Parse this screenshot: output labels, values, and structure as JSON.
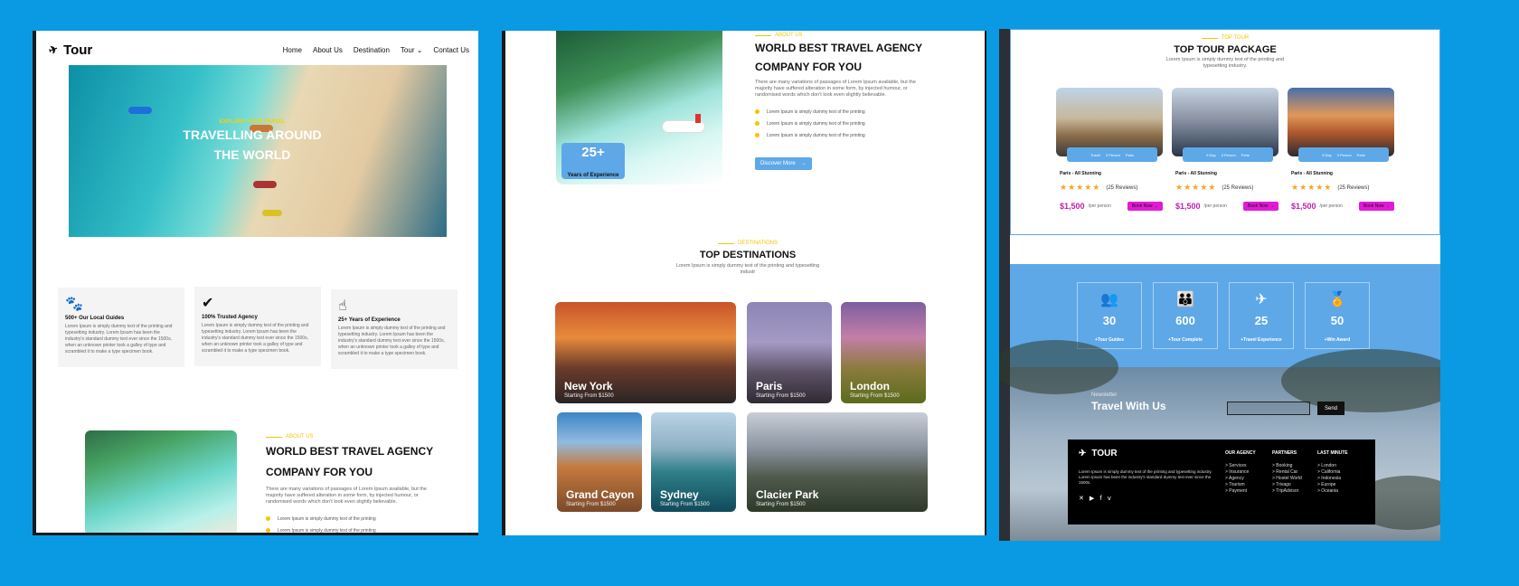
{
  "panel1": {
    "brand": "Tour",
    "nav": [
      "Home",
      "About Us",
      "Destination",
      "Tour",
      "Contact Us"
    ],
    "hero": {
      "eyebrow": "EXPLORE YOUR TRAVEL",
      "title_line1": "TRAVELLING AROUND",
      "title_line2": "THE WORLD"
    },
    "features": [
      {
        "icon": "paw-icon",
        "title": "500+ Our Local Guides",
        "text": "Lorem Ipsum is simply dummy text of the printing and typesetting industry. Lorem Ipsum has been the industry's standard dummy text ever since the 1500s, when an unknown printer took a galley of type and scrambled it to make a type specimen book."
      },
      {
        "icon": "check-circle-icon",
        "title": "100% Trusted Agency",
        "text": "Lorem Ipsum is simply dummy text of the printing and typesetting industry. Lorem Ipsum has been the industry's standard dummy text ever since the 1500s, when an unknown printer took a galley of type and scrambled it to make a type specimen book."
      },
      {
        "icon": "hand-heart-icon",
        "title": "25+ Years of Experience",
        "text": "Lorem Ipsum is simply dummy text of the printing and typesetting industry. Lorem Ipsum has been the industry's standard dummy text ever since the 1500s, when an unknown printer took a galley of type and scrambled it to make a type specimen book."
      }
    ],
    "about": {
      "eyebrow": "ABOUT US",
      "title_line1": "WORLD BEST TRAVEL AGENCY",
      "title_line2": "COMPANY FOR YOU",
      "text": "There are many variations of passages of Lorem Ipsum available, but the majority have suffered alteration in some form, by injected humour, or randomised words which don't look even slightly believable.",
      "bullets": [
        "Lorem Ipsum is simply dummy text of the printing",
        "Lorem Ipsum is simply dummy text of the printing"
      ]
    }
  },
  "panel2": {
    "experience": {
      "value": "25+",
      "label": "Years of Experience"
    },
    "about": {
      "eyebrow": "ABOUT US",
      "title_line1": "WORLD BEST TRAVEL AGENCY",
      "title_line2": "COMPANY FOR YOU",
      "text": "There are many variations of passages of Lorem Ipsum available, but the majority have suffered alteration in some form, by injected humour, or randomised words which don't look even slightly believable.",
      "bullets": [
        "Lorem Ipsum is simply dummy text of the printing",
        "Lorem Ipsum is simply dummy text of the printing",
        "Lorem Ipsum is simply dummy text of the printing"
      ],
      "button": "Discover More"
    },
    "destinations": {
      "eyebrow": "DESTINATIONS",
      "title": "TOP DESTINATIONS",
      "subtitle": "Lorem Ipsum is simply dummy text of the printing and typesetting industr",
      "items": [
        {
          "name": "New York",
          "price": "Starting From $1500"
        },
        {
          "name": "Paris",
          "price": "Starting From $1500"
        },
        {
          "name": "London",
          "price": "Starting From $1500"
        },
        {
          "name": "Grand Cayon",
          "price": "Starting From $1500"
        },
        {
          "name": "Sydney",
          "price": "Starting From $1500"
        },
        {
          "name": "Clacier Park",
          "price": "Starting From $1500"
        }
      ]
    }
  },
  "panel3": {
    "packages": {
      "eyebrow": "TOP TOUR",
      "title": "TOP TOUR PACKAGE",
      "subtitle": "Lorem Ipsum is simply dummy text of the printing and typesetting industry.",
      "cards": [
        {
          "meta": [
            "Travel",
            "3 Person",
            "Paris"
          ],
          "title": "Paris - All Stunning",
          "reviews": "(25 Reviews)",
          "price": "$1,500",
          "per": "/per person",
          "button": "Book Now"
        },
        {
          "meta": [
            "5 Day",
            "3 Person",
            "Paris"
          ],
          "title": "Paris - All Stunning",
          "reviews": "(25 Reviews)",
          "price": "$1,500",
          "per": "/per person",
          "button": "Book Now"
        },
        {
          "meta": [
            "5 Day",
            "3 Person",
            "Paris"
          ],
          "title": "Paris - All Stunning",
          "reviews": "(25 Reviews)",
          "price": "$1,500",
          "per": "/per person",
          "button": "Book Now"
        }
      ]
    },
    "stats": [
      {
        "icon": "users-icon",
        "value": "30",
        "label": "+Tour Guides"
      },
      {
        "icon": "group-icon",
        "value": "600",
        "label": "+Tour Complete"
      },
      {
        "icon": "hand-plane-icon",
        "value": "25",
        "label": "+Travel Experience"
      },
      {
        "icon": "award-icon",
        "value": "50",
        "label": "+Win Award"
      }
    ],
    "newsletter": {
      "small": "Newsletter",
      "title": "Travel With Us",
      "button": "Send"
    },
    "footer": {
      "brand": "TOUR",
      "desc": "Lorem Ipsum is simply dummy text of the printing and typesetting industry. Lorem Ipsum has been the industry's standard dummy text ever since the 1500s.",
      "col1": {
        "title": "OUR AGENCY",
        "items": [
          "> Services",
          "> Insurance",
          "> Agency",
          "> Tourism",
          "> Payment"
        ]
      },
      "col2": {
        "title": "PARTNERS",
        "items": [
          "> Booking",
          "> Rental Car",
          "> Hostel World",
          "> Trivago",
          "> TripAdvisor"
        ]
      },
      "col3": {
        "title": "LAST MINUTE",
        "items": [
          "> London",
          "> California",
          "> Indonesia",
          "> Europe",
          "> Oceania"
        ]
      }
    }
  },
  "colors": {
    "accent_blue": "#5ea8e8",
    "accent_yellow": "#f6c400",
    "price_magenta": "#c41fb0",
    "button_magenta": "#e21ad6",
    "background": "#0a9ae3"
  }
}
